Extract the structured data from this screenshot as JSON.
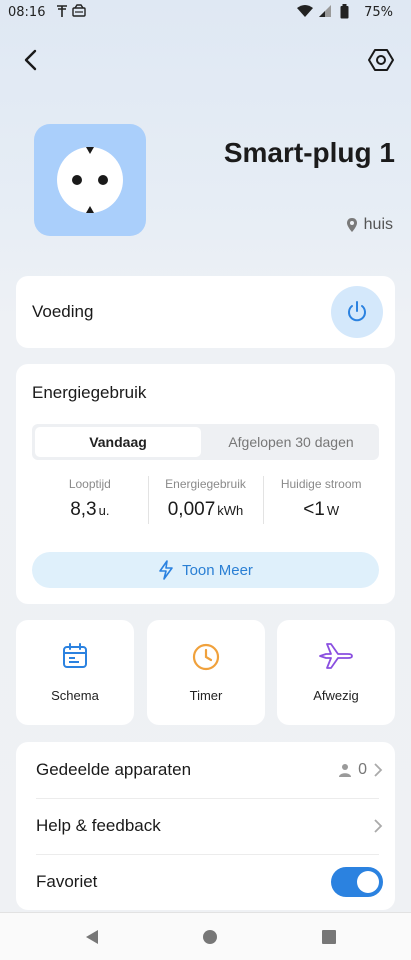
{
  "status_bar": {
    "time": "08:16",
    "battery": "75%"
  },
  "device": {
    "name": "Smart-plug 1",
    "location": "huis"
  },
  "power": {
    "label": "Voeding"
  },
  "energy": {
    "title": "Energiegebruik",
    "tabs": [
      "Vandaag",
      "Afgelopen 30 dagen"
    ],
    "stats": [
      {
        "label": "Looptijd",
        "value": "8,3",
        "unit": "u."
      },
      {
        "label": "Energiegebruik",
        "value": "0,007",
        "unit": "kWh"
      },
      {
        "label": "Huidige stroom",
        "value": "<1",
        "unit": "W"
      }
    ],
    "more_label": "Toon Meer"
  },
  "actions": [
    {
      "label": "Schema",
      "icon": "calendar-icon",
      "color": "#2b82e0"
    },
    {
      "label": "Timer",
      "icon": "clock-icon",
      "color": "#f0a13c"
    },
    {
      "label": "Afwezig",
      "icon": "airplane-icon",
      "color": "#8a4fe0"
    }
  ],
  "list": {
    "shared": {
      "label": "Gedeelde apparaten",
      "count": "0"
    },
    "help": {
      "label": "Help & feedback"
    },
    "favorite": {
      "label": "Favoriet",
      "on": true
    }
  },
  "colors": {
    "accent": "#2b82e0",
    "tile": "#aacffb"
  }
}
